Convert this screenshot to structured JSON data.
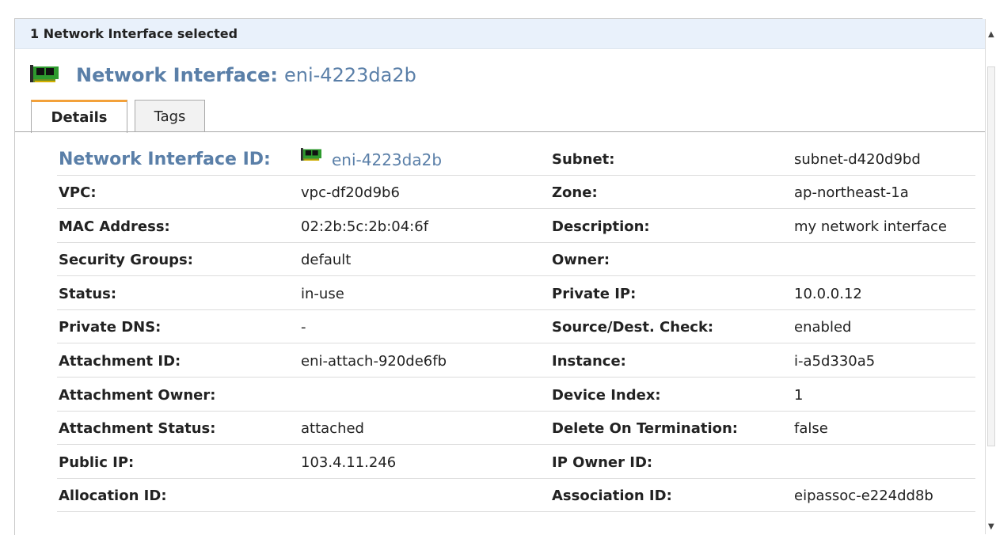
{
  "header": {
    "selected_text": "1 Network Interface selected"
  },
  "title": {
    "label": "Network Interface:",
    "value": "eni-4223da2b"
  },
  "tabs": [
    {
      "label": "Details"
    },
    {
      "label": "Tags"
    }
  ],
  "first_row": {
    "id_label": "Network Interface ID:",
    "id_value": "eni-4223da2b",
    "subnet_label": "Subnet:",
    "subnet_value": "subnet-d420d9bd"
  },
  "left_rows": [
    {
      "label": "VPC:",
      "value": "vpc-df20d9b6"
    },
    {
      "label": "MAC Address:",
      "value": "02:2b:5c:2b:04:6f"
    },
    {
      "label": "Security Groups:",
      "value": "default"
    },
    {
      "label": "Status:",
      "value": "in-use"
    },
    {
      "label": "Private DNS:",
      "value": "-"
    },
    {
      "label": "Attachment ID:",
      "value": "eni-attach-920de6fb"
    },
    {
      "label": "Attachment Owner:",
      "value": ""
    },
    {
      "label": "Attachment Status:",
      "value": "attached"
    },
    {
      "label": "Public IP:",
      "value": "103.4.11.246"
    },
    {
      "label": "Allocation ID:",
      "value": ""
    }
  ],
  "right_rows": [
    {
      "label": "Zone:",
      "value": "ap-northeast-1a"
    },
    {
      "label": "Description:",
      "value": "my network interface"
    },
    {
      "label": "Owner:",
      "value": ""
    },
    {
      "label": "Private IP:",
      "value": "10.0.0.12"
    },
    {
      "label": "Source/Dest. Check:",
      "value": "enabled"
    },
    {
      "label": "Instance:",
      "value": "i-a5d330a5"
    },
    {
      "label": "Device Index:",
      "value": "1"
    },
    {
      "label": "Delete On Termination:",
      "value": "false"
    },
    {
      "label": "IP Owner ID:",
      "value": ""
    },
    {
      "label": "Association ID:",
      "value": "eipassoc-e224dd8b"
    }
  ],
  "icons": {
    "title_icon": "network-card-icon",
    "id_icon": "network-card-icon"
  },
  "colors": {
    "title_blue": "#5a7fa8",
    "header_bg": "#e9f1fb",
    "tab_accent": "#f3a13a",
    "icon_green": "#2e9a2e"
  }
}
